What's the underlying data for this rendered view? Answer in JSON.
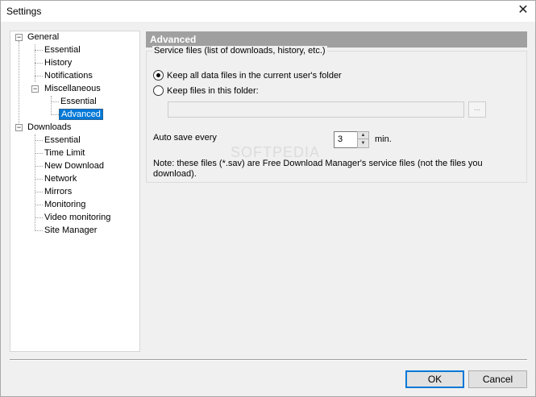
{
  "window": {
    "title": "Settings",
    "close_glyph": "✕"
  },
  "tree": {
    "items": [
      {
        "label": "General",
        "expander": "−"
      },
      {
        "label": "Essential"
      },
      {
        "label": "History"
      },
      {
        "label": "Notifications"
      },
      {
        "label": "Miscellaneous",
        "expander": "−"
      },
      {
        "label": "Essential"
      },
      {
        "label": "Advanced",
        "selected": true
      },
      {
        "label": "Downloads",
        "expander": "−"
      },
      {
        "label": "Essential"
      },
      {
        "label": "Time Limit"
      },
      {
        "label": "New Download"
      },
      {
        "label": "Network"
      },
      {
        "label": "Mirrors"
      },
      {
        "label": "Monitoring"
      },
      {
        "label": "Video monitoring"
      },
      {
        "label": "Site Manager"
      }
    ]
  },
  "panel": {
    "header": "Advanced",
    "group_title": "Service files (list of downloads, history, etc.)",
    "radio_current_user": "Keep all data files in the current user's folder",
    "radio_this_folder": "Keep files in this folder:",
    "folder_value": "",
    "browse_label": "...",
    "autosave_label": "Auto save every",
    "autosave_value": "3",
    "autosave_unit": "min.",
    "note": "Note: these files (*.sav) are Free Download Manager's service files (not the files you download)."
  },
  "watermark": "SOFTPEDIA",
  "buttons": {
    "ok": "OK",
    "cancel": "Cancel"
  },
  "colors": {
    "selection": "#0078d7",
    "header_bg": "#a0a0a0"
  }
}
